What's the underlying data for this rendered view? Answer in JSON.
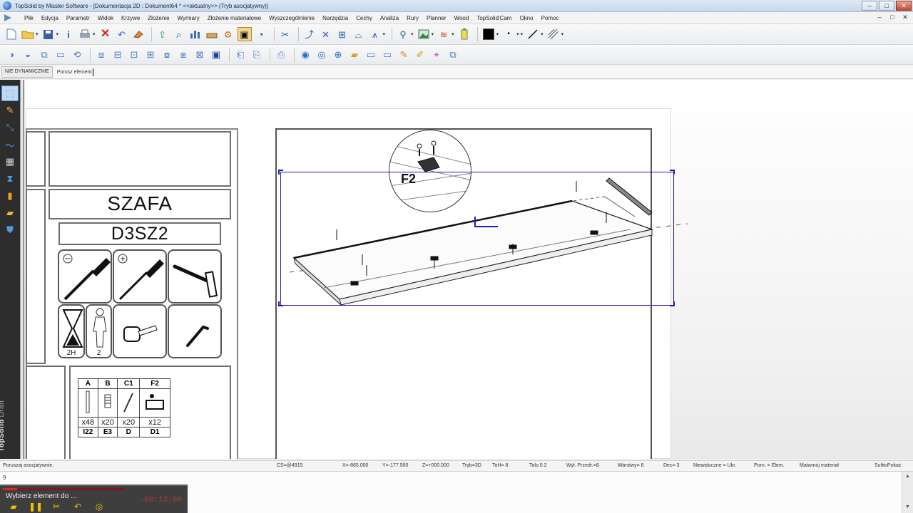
{
  "window": {
    "title": "TopSolid by Missler Software - [Dokumentacja 2D : Dokument64 *  <<aktualny>> (Tryb asocjatywny)]",
    "buttons": [
      "–",
      "□",
      "✕"
    ]
  },
  "menubar": {
    "items": [
      "Plik",
      "Edycja",
      "Parametr",
      "Widok",
      "Krzywe",
      "Złożenie",
      "Wymiary",
      "Złożenie materiałowe",
      "Wyszczególnienie",
      "Narzędzia",
      "Cechy",
      "Analiza",
      "Rury",
      "Planner",
      "Wood",
      "TopSolid'Cam",
      "Okno",
      "Pomoc"
    ],
    "mdi_buttons": [
      "–",
      "□",
      "✕"
    ]
  },
  "toolbar1": {
    "icons": [
      "new-file",
      "open-folder",
      "save",
      "info",
      "print",
      "delete",
      "undo",
      "eraser",
      "arrow-up",
      "search-3d",
      "chart-bars",
      "sofa",
      "gears",
      "fit-view",
      "orbit",
      "cut",
      "pick",
      "measure",
      "snap",
      "sketch",
      "zoom",
      "image",
      "layers",
      "bin",
      "battery"
    ],
    "color_swatch": "#000000",
    "line_tools": [
      "dot",
      "line",
      "hatch"
    ]
  },
  "toolbar2": {
    "icons": [
      "view-a",
      "view-b",
      "view-c",
      "view-d",
      "view-e",
      "grid-a",
      "grid-b",
      "grid-c",
      "grid-d",
      "grid-e",
      "grid-f",
      "grid-g",
      "frame",
      "sheet-a",
      "sheet-b",
      "sheet-c",
      "globe-a",
      "globe-b",
      "globe-c",
      "folder",
      "rect-a",
      "rect-b",
      "pen-a",
      "pen-b",
      "target",
      "stamp"
    ]
  },
  "command_bar": {
    "mode_tab": "NIE DYNAMICZNIE",
    "prompt": "Porusz element"
  },
  "left_dock": {
    "tools": [
      "select",
      "pencil",
      "dimension",
      "curve",
      "table",
      "chart",
      "bolt",
      "folder",
      "shield"
    ],
    "brand_bold": "TopSolid",
    "brand_light": "'Draft"
  },
  "title_block": {
    "product_name": "SZAFA",
    "product_code": "D3SZ2",
    "tools": [
      {
        "name": "screwdriver-flat",
        "caption": ""
      },
      {
        "name": "screwdriver-phillips",
        "caption": ""
      },
      {
        "name": "hammer",
        "caption": ""
      },
      {
        "name": "hourglass",
        "caption": "2H"
      },
      {
        "name": "person",
        "caption": "2"
      },
      {
        "name": "tape-measure",
        "caption": ""
      },
      {
        "name": "allen-key",
        "caption": ""
      }
    ],
    "hardware": {
      "headers": [
        "A",
        "B",
        "C1",
        "F2"
      ],
      "quantities": [
        "x48",
        "x20",
        "x20",
        "x12"
      ],
      "headers2": [
        "I22",
        "E3",
        "D",
        "D1"
      ]
    }
  },
  "drawing": {
    "detail_label": "F2"
  },
  "status": {
    "message": "Poruszaj asocjatywnie.",
    "cs": "CS=@4915",
    "x": "X=-865.000",
    "y": "Y=-177.500",
    "z": "Z=+000.000",
    "mode": "Tryb=3D",
    "toh": "ToH= 8",
    "tolo": "Tolo  0.2",
    "wyl": "Wył. Przedr.=8",
    "warstwy": "Warstwy= 8",
    "dec": "Dec= 3",
    "niewid": "Niewidoczne = Ukr.",
    "porn": "Porn. = Elem.",
    "mat": "Matwmój materiał",
    "suffix": "SufitoPokaż"
  },
  "bottom_panel": {
    "line1": "9",
    "scroll": [
      "▲",
      "▼"
    ]
  },
  "video_overlay": {
    "caption": "Wybierz element do ...",
    "time": "-00:13:00",
    "progress": 0.12,
    "controls": [
      "folder",
      "pause",
      "cut",
      "undo",
      "record"
    ]
  },
  "colors": {
    "selection": "#1c1cb4",
    "dock_bg": "#2d2d2d",
    "accent_blue": "#4c9be5"
  }
}
